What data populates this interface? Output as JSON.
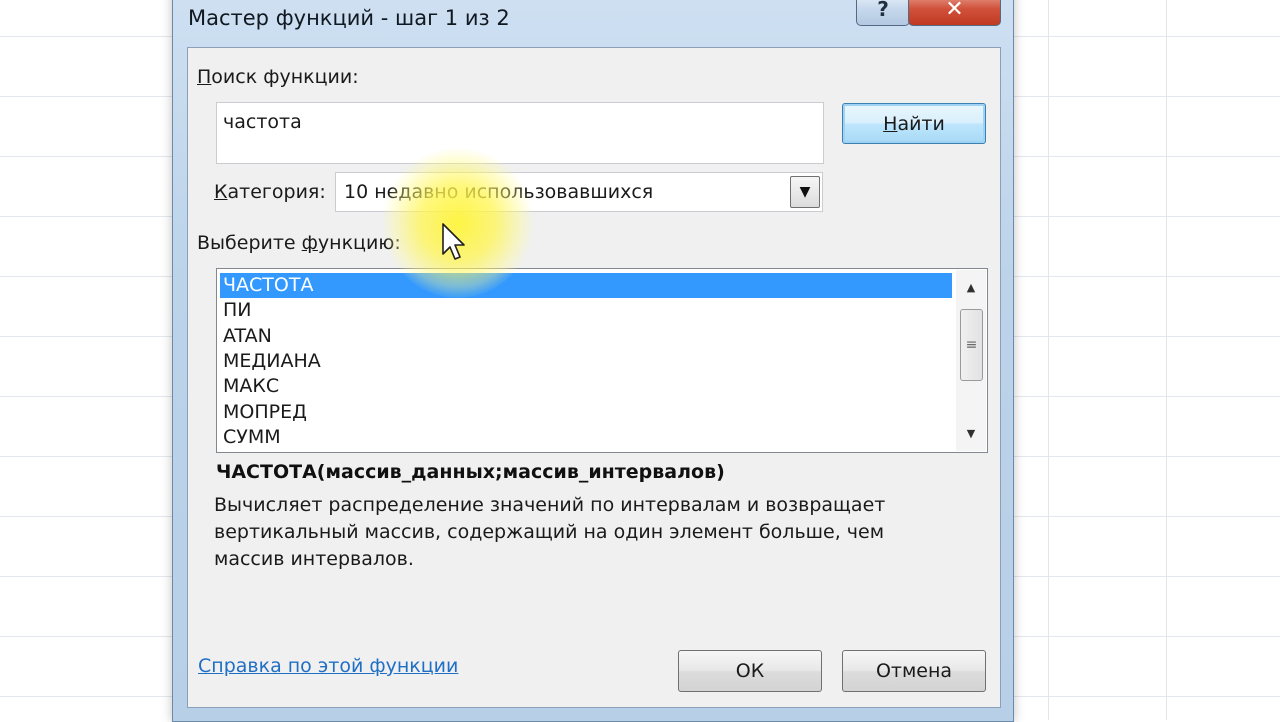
{
  "window": {
    "title": "Мастер функций - шаг 1 из 2",
    "help_glyph": "?",
    "close_glyph": "✕"
  },
  "search": {
    "label_pre": "",
    "label_u": "П",
    "label_post": "оиск функции:",
    "value": "частота",
    "find_pre": "",
    "find_u": "Н",
    "find_post": "айти"
  },
  "category": {
    "label_pre": "",
    "label_u": "К",
    "label_post": "атегория:",
    "selected": "10 недавно использовавшихся",
    "arrow_icon": "▼"
  },
  "function_list": {
    "label_pre": "Выберите ",
    "label_u": "ф",
    "label_post": "ункцию:",
    "items": [
      "ЧАСТОТА",
      "ПИ",
      "ATAN",
      "МЕДИАНА",
      "МАКС",
      "МОПРЕД",
      "СУММ"
    ],
    "selected_index": 0,
    "scroll_up_icon": "▲",
    "scroll_down_icon": "▼",
    "thumb_grip": "≡"
  },
  "details": {
    "signature": "ЧАСТОТА(массив_данных;массив_интервалов)",
    "description": "Вычисляет распределение значений по интервалам и возвращает вертикальный массив, содержащий на один элемент больше, чем массив интервалов."
  },
  "footer": {
    "help_link": "Справка по этой функции",
    "ok_label": "ОК",
    "cancel_label": "Отмена"
  },
  "colors": {
    "selection": "#3399ff",
    "link": "#1f6fc5",
    "close_button": "#c13a22"
  }
}
